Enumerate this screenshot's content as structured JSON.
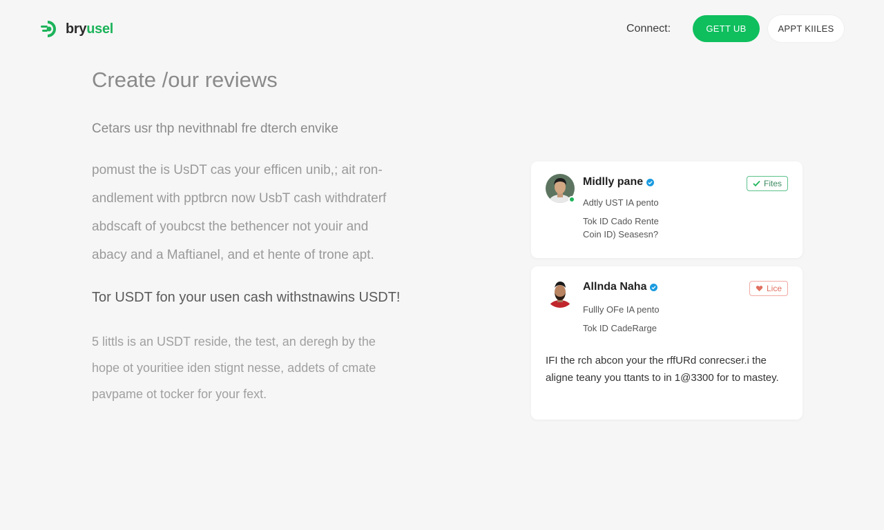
{
  "header": {
    "logo_text_a": "bry",
    "logo_text_b": "usel",
    "connect_label": "Connect:",
    "primary_button": "GETT UB",
    "secondary_button": "APPT KIILES"
  },
  "hero": {
    "title": "Create /our reviews",
    "lead": "Cetars usr thp nevithnabl fre dterch envike",
    "paragraph": [
      "pomust the is UsDT cas your efficen unib,; ait ron-",
      "andlement with pptbrcn now UsbT cash withdraterf",
      "abdscaft of youbcst the bethencer not youir and",
      "abacy and a Maftianel, and et hente of trone apt."
    ],
    "subhead": "Tor USDT fon your usen cash withstnawins USDT!",
    "note": [
      "5 littls is an USDT reside, the test, an deregh by the",
      "hope ot youritiee iden stignt nesse, addets of cmate",
      "pavpame ot tocker for your fext."
    ]
  },
  "cards": [
    {
      "name": "Midlly pane",
      "line1": "Adtly UST IA pento",
      "line2": "Tok ID Cado Rente",
      "line3": "Coin ID) Seasesn?",
      "badge": "Fites",
      "badge_icon": "check-icon",
      "accent": "#1db35a"
    },
    {
      "name": "Allnda Naha",
      "line1": "Fullly OFe IA pento",
      "line2": "Tok ID CadeRarge",
      "badge": "Lice",
      "badge_icon": "heart-icon",
      "accent": "#e07060",
      "review": "IFI the rch abcon your the rffURd conrecser.i the aligne teany you ttants to in 1@3300 for to mastey."
    }
  ],
  "colors": {
    "brand_green": "#0fbf5e",
    "verified_blue": "#1a9be0"
  }
}
